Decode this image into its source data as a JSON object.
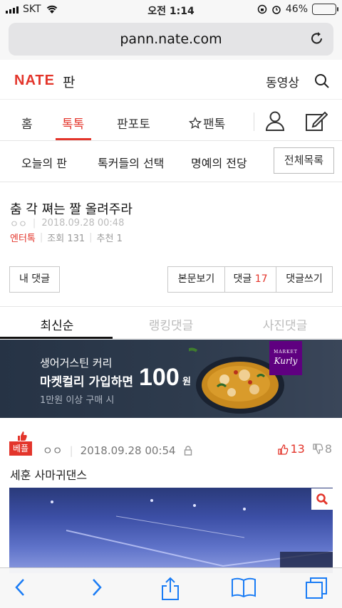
{
  "status_bar": {
    "carrier": "SKT",
    "time": "오전 1:14",
    "battery_percent": "46%",
    "battery_level": 0.46
  },
  "browser": {
    "url": "pann.nate.com"
  },
  "site_header": {
    "logo": "NATE",
    "logo_sub": "판",
    "video_link": "동영상"
  },
  "main_tabs": [
    {
      "label": "홈"
    },
    {
      "label": "톡톡",
      "active": true
    },
    {
      "label": "판포토"
    },
    {
      "label": "팬톡"
    }
  ],
  "sub_nav": {
    "items": [
      "오늘의 판",
      "톡커들의 선택",
      "명예의 전당"
    ],
    "all_button": "전체목록"
  },
  "post": {
    "title": "춤 각 쪄는 짤 올려주라",
    "author": "ㅇㅇ",
    "date": "2018.09.28 00:48",
    "category": "엔터톡",
    "views": "조회 131",
    "recommend": "추천 1"
  },
  "actions": {
    "my_comments": "내 댓글",
    "view_post": "본문보기",
    "comments_label": "댓글",
    "comments_count": "17",
    "write_comment": "댓글쓰기"
  },
  "comment_tabs": [
    "최신순",
    "랭킹댓글",
    "사진댓글"
  ],
  "ad": {
    "line1": "생어거스틴 커리",
    "line2": "마켓컬리 가입하면",
    "amount": "100",
    "unit": "원",
    "line3": "1만원 이상 구매 시",
    "brand_top": "MARKET",
    "brand": "Kurly"
  },
  "comment": {
    "badge": "베플",
    "author": "ㅇㅇ",
    "date": "2018.09.28 00:54",
    "up": "13",
    "down": "8",
    "text": "세훈 사마귀댄스"
  },
  "colors": {
    "accent": "#e3352b",
    "ad_bg": "#2e3b4d",
    "toolbar_icon": "#1a7cf5"
  }
}
